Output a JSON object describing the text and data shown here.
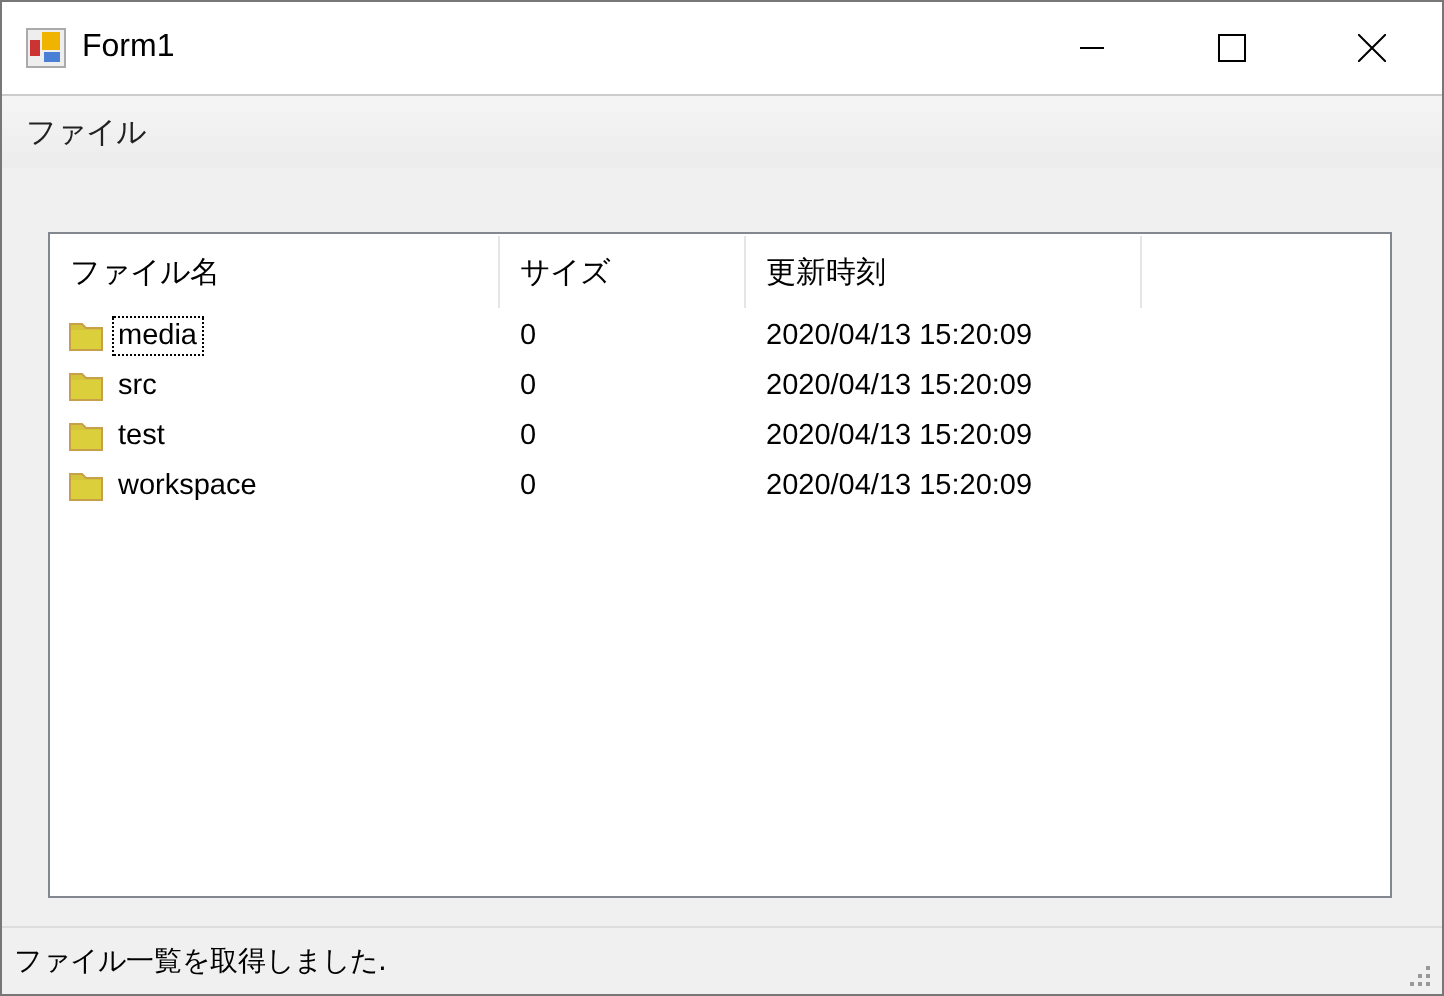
{
  "window": {
    "title": "Form1"
  },
  "menu": [
    "ファイル"
  ],
  "list": {
    "columns": [
      "ファイル名",
      "サイズ",
      "更新時刻"
    ],
    "rows": [
      {
        "name": "media",
        "size": "0",
        "modified": "2020/04/13 15:20:09",
        "focused": true
      },
      {
        "name": "src",
        "size": "0",
        "modified": "2020/04/13 15:20:09",
        "focused": false
      },
      {
        "name": "test",
        "size": "0",
        "modified": "2020/04/13 15:20:09",
        "focused": false
      },
      {
        "name": "workspace",
        "size": "0",
        "modified": "2020/04/13 15:20:09",
        "focused": false
      }
    ]
  },
  "status_bar": "ファイル一覧を取得しました."
}
